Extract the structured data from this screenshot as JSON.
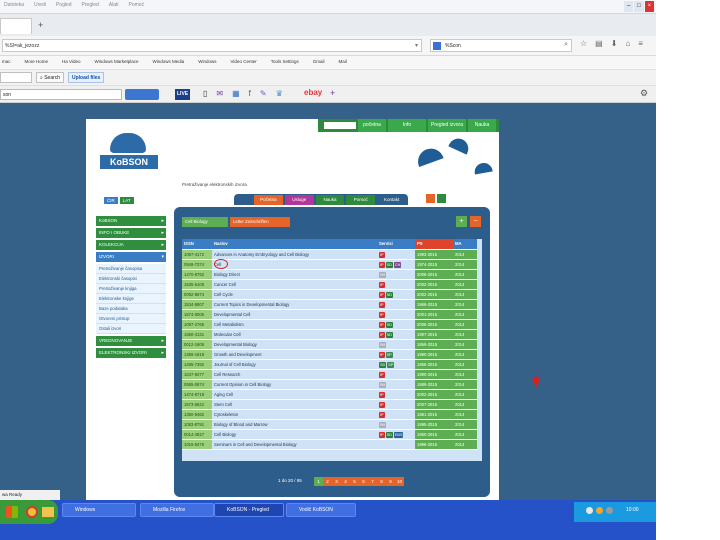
{
  "browser": {
    "new_tab_label": "+",
    "address_text": "%SI=ak_jezozz",
    "search_text": "%Scon",
    "search_icon": "search-icon",
    "toolbar_search_label": "Search",
    "upload_label": "Upload files",
    "small_field_value": "son",
    "live_label": "LIVE",
    "ebay_label": "ebay",
    "menu_items": [
      "Datoteka",
      "Uredi",
      "Pogled",
      "Pregled",
      "Alati",
      "Pomoć"
    ],
    "bookmarks": [
      "mac",
      "More Home",
      "Ha Video",
      "Windows Marketplace",
      "Windows Media",
      "Windows",
      "Video Center",
      "Tools Settings",
      "Gmail",
      "Mail"
    ]
  },
  "site": {
    "logo_text": "KoBSON",
    "intro_text": "Pretraživanje elektronskih izvora",
    "top_tabs": [
      "početna",
      "Info",
      "Pregled izvora",
      "Nauka",
      "Kontakt"
    ],
    "nav_tabs": [
      "Početna",
      "Usluge",
      "Nauka",
      "Pomoć",
      "Kontakt"
    ],
    "left_tabs": [
      "ĆIR",
      "LAT"
    ],
    "sidebar": [
      {
        "label": "KoBSON",
        "expanded": false
      },
      {
        "label": "INFO I OBUKE",
        "expanded": false
      },
      {
        "label": "KOLEKCIJA",
        "expanded": false
      },
      {
        "label": "IZVORI",
        "expanded": true
      },
      {
        "label": "VREDNOVANJE",
        "expanded": false
      },
      {
        "label": "ELEKTRONSKI IZVORI",
        "expanded": false
      }
    ],
    "sublinks": [
      "Pretraživanje časopisa",
      "Elektronski časopisi",
      "Pretraživanje knjiga",
      "Elektronske knjige",
      "Baze podataka",
      "Otvoreni pristup",
      "Ostali izvori"
    ],
    "panel_tabs": [
      "Cell Biology",
      "Letter Zeitschriften"
    ],
    "table": {
      "headers": [
        "ISSN",
        "Naslov",
        "Servisi",
        "PS",
        "MA"
      ],
      "rows": [
        {
          "issn": "1097-4172",
          "title": "Advances in Anatomy Embryology and Cell Biology",
          "badges": [
            "ip"
          ],
          "ps": "1993-2015",
          "ma": "2014"
        },
        {
          "issn": "0949-7374",
          "title": "Cell",
          "badges": [
            "ip",
            "sd",
            "ch"
          ],
          "ps": "1974-2015",
          "ma": "2014"
        },
        {
          "issn": "1470-8752",
          "title": "Biology Direct",
          "badges": [
            "sh"
          ],
          "ps": "2006-2015",
          "ma": "2014"
        },
        {
          "issn": "1535-6108",
          "title": "Cancer Cell",
          "badges": [
            "ip"
          ],
          "ps": "2002-2015",
          "ma": "2014"
        },
        {
          "issn": "0092-8674",
          "title": "Cell Cycle",
          "badges": [
            "ip",
            "sd"
          ],
          "ps": "2002-2015",
          "ma": "2014"
        },
        {
          "issn": "1534-5807",
          "title": "Current Topics in Developmental Biology",
          "badges": [
            "ip"
          ],
          "ps": "1966-2015",
          "ma": "2014"
        },
        {
          "issn": "1574-0005",
          "title": "Developmental Cell",
          "badges": [
            "ip"
          ],
          "ps": "2001-2015",
          "ma": "2014"
        },
        {
          "issn": "1097-2765",
          "title": "Cell Metabolism",
          "badges": [
            "ip",
            "sd"
          ],
          "ps": "2005-2015",
          "ma": "2014"
        },
        {
          "issn": "1550-4131",
          "title": "Molecular Cell",
          "badges": [
            "ip",
            "sd"
          ],
          "ps": "1997-2015",
          "ma": "2014"
        },
        {
          "issn": "0012-1606",
          "title": "Developmental Biology",
          "badges": [
            "sh"
          ],
          "ps": "1959-2015",
          "ma": "2014"
        },
        {
          "issn": "1369-1818",
          "title": "Growth and Development",
          "badges": [
            "ip",
            "sp"
          ],
          "ps": "1990-2015",
          "ma": "2014"
        },
        {
          "issn": "1465-7392",
          "title": "Journal of Cell Biology",
          "badges": [
            "sd",
            "sp"
          ],
          "ps": "1955-2015",
          "ma": "2014"
        },
        {
          "issn": "1047-8477",
          "title": "Cell Research",
          "badges": [
            "ip"
          ],
          "ps": "1990-2015",
          "ma": "2014"
        },
        {
          "issn": "0955-0674",
          "title": "Current Opinion in Cell Biology",
          "badges": [
            "sh"
          ],
          "ps": "1989-2015",
          "ma": "2014"
        },
        {
          "issn": "1474-9718",
          "title": "Aging Cell",
          "badges": [
            "ip"
          ],
          "ps": "2002-2015",
          "ma": "2014"
        },
        {
          "issn": "1573-6822",
          "title": "Stem Cell",
          "badges": [
            "ip"
          ],
          "ps": "2007-2015",
          "ma": "2014"
        },
        {
          "issn": "1350-9462",
          "title": "Cytoskeleton",
          "badges": [
            "ip"
          ],
          "ps": "1981-2015",
          "ma": "2014"
        },
        {
          "issn": "1083-8791",
          "title": "Biology of Blood and Marrow",
          "badges": [
            "sh"
          ],
          "ps": "1995-2015",
          "ma": "2014"
        },
        {
          "issn": "0014-4827",
          "title": "Cell Biology",
          "badges": [
            "ip",
            "sd",
            "ebs"
          ],
          "ps": "1950-2015",
          "ma": "2014"
        },
        {
          "issn": "1016-8478",
          "title": "Seminars in Cell and Developmental Biology",
          "badges": [],
          "ps": "1996-2015",
          "ma": "2014"
        }
      ]
    },
    "pager": {
      "range_text": "1 do 20 / 95",
      "pages": [
        "1",
        "2",
        "3",
        "4",
        "5",
        "6",
        "7",
        "8",
        "9",
        "10"
      ]
    },
    "plus_label": "+",
    "minus_label": "−"
  },
  "taskbar": {
    "items": [
      "Windows",
      "Mozilla Firefox",
      "KoBSON - Pregled",
      "Vodič KoBSON"
    ],
    "clock": "10:00"
  },
  "status_text": "wa Ready"
}
